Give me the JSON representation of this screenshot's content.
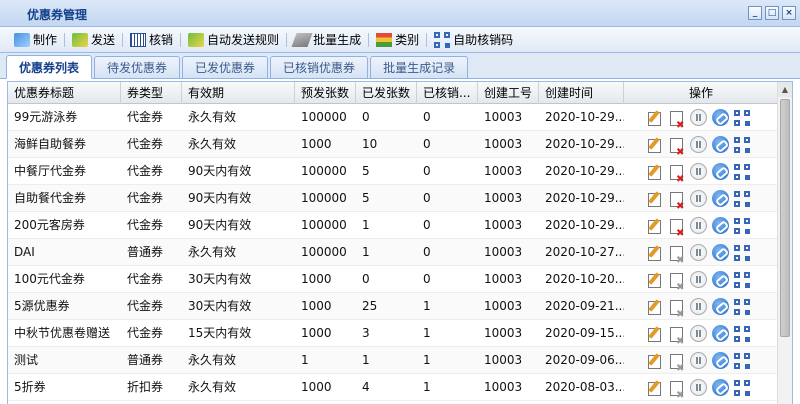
{
  "window": {
    "title": "优惠券管理",
    "controls": [
      "_",
      "□",
      "×"
    ]
  },
  "toolbar": [
    {
      "label": "制作",
      "icon": "coupon-make-icon"
    },
    {
      "label": "发送",
      "icon": "send-icon"
    },
    {
      "label": "核销",
      "icon": "barcode-icon"
    },
    {
      "label": "自动发送规则",
      "icon": "auto-send-icon"
    },
    {
      "label": "批量生成",
      "icon": "batch-icon"
    },
    {
      "label": "类别",
      "icon": "category-icon"
    },
    {
      "label": "自助核销码",
      "icon": "qr-icon"
    }
  ],
  "tabs": [
    "优惠券列表",
    "待发优惠券",
    "已发优惠券",
    "已核销优惠券",
    "批量生成记录"
  ],
  "grid": {
    "columns": [
      "优惠券标题",
      "券类型",
      "有效期",
      "预发张数",
      "已发张数",
      "已核销...",
      "创建工号",
      "创建时间",
      "操作"
    ],
    "rows": [
      {
        "title": "99元游泳券",
        "type": "代金券",
        "validity": "永久有效",
        "planned": "100000",
        "sent": "0",
        "redeemed": "0",
        "creator": "10003",
        "created": "2020-10-29...",
        "del_enabled": true
      },
      {
        "title": "海鲜自助餐券",
        "type": "代金券",
        "validity": "永久有效",
        "planned": "1000",
        "sent": "10",
        "redeemed": "0",
        "creator": "10003",
        "created": "2020-10-29...",
        "del_enabled": true
      },
      {
        "title": "中餐厅代金券",
        "type": "代金券",
        "validity": "90天内有效",
        "planned": "100000",
        "sent": "5",
        "redeemed": "0",
        "creator": "10003",
        "created": "2020-10-29...",
        "del_enabled": true
      },
      {
        "title": "自助餐代金券",
        "type": "代金券",
        "validity": "90天内有效",
        "planned": "100000",
        "sent": "5",
        "redeemed": "0",
        "creator": "10003",
        "created": "2020-10-29...",
        "del_enabled": true
      },
      {
        "title": "200元客房券",
        "type": "代金券",
        "validity": "90天内有效",
        "planned": "100000",
        "sent": "1",
        "redeemed": "0",
        "creator": "10003",
        "created": "2020-10-29...",
        "del_enabled": true
      },
      {
        "title": "DAI",
        "type": "普通券",
        "validity": "永久有效",
        "planned": "100000",
        "sent": "1",
        "redeemed": "0",
        "creator": "10003",
        "created": "2020-10-27...",
        "del_enabled": false
      },
      {
        "title": "100元代金券",
        "type": "代金券",
        "validity": "30天内有效",
        "planned": "1000",
        "sent": "0",
        "redeemed": "0",
        "creator": "10003",
        "created": "2020-10-20...",
        "del_enabled": false
      },
      {
        "title": "5源优惠券",
        "type": "代金券",
        "validity": "30天内有效",
        "planned": "1000",
        "sent": "25",
        "redeemed": "1",
        "creator": "10003",
        "created": "2020-09-21...",
        "del_enabled": false
      },
      {
        "title": "中秋节优惠卷赠送",
        "type": "代金券",
        "validity": "15天内有效",
        "planned": "1000",
        "sent": "3",
        "redeemed": "1",
        "creator": "10003",
        "created": "2020-09-15...",
        "del_enabled": false
      },
      {
        "title": "测试",
        "type": "普通券",
        "validity": "永久有效",
        "planned": "1",
        "sent": "1",
        "redeemed": "1",
        "creator": "10003",
        "created": "2020-09-06...",
        "del_enabled": false
      },
      {
        "title": "5折券",
        "type": "折扣券",
        "validity": "永久有效",
        "planned": "1000",
        "sent": "4",
        "redeemed": "1",
        "creator": "10003",
        "created": "2020-08-03...",
        "del_enabled": false
      }
    ]
  },
  "colors": {
    "title_text": "#15428b",
    "border": "#99bbe8",
    "delete_red": "#d42020",
    "link_blue": "#1f67c8"
  }
}
